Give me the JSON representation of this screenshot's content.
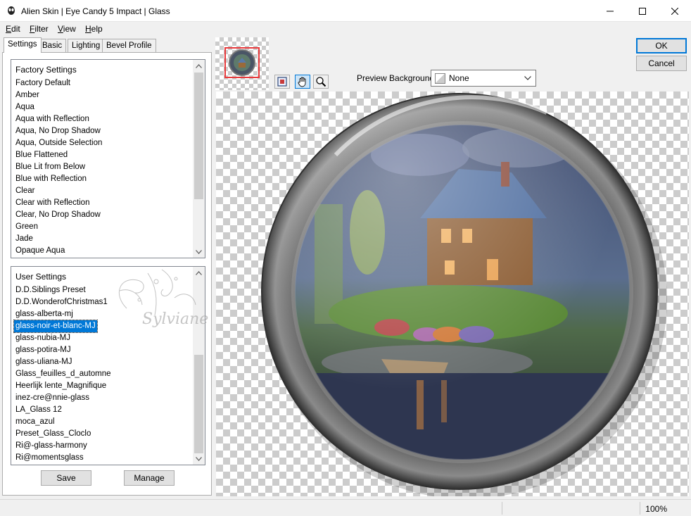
{
  "window": {
    "title": "Alien Skin | Eye Candy 5 Impact | Glass",
    "controls": [
      "minimize",
      "maximize",
      "close"
    ]
  },
  "menu": [
    {
      "label": "Edit",
      "accel": "E",
      "rest": "dit"
    },
    {
      "label": "Filter",
      "accel": "F",
      "rest": "ilter"
    },
    {
      "label": "View",
      "accel": "V",
      "rest": "iew"
    },
    {
      "label": "Help",
      "accel": "H",
      "rest": "elp"
    }
  ],
  "tabs": [
    {
      "label": "Settings",
      "active": true
    },
    {
      "label": "Basic",
      "active": false
    },
    {
      "label": "Lighting",
      "active": false
    },
    {
      "label": "Bevel Profile",
      "active": false
    }
  ],
  "factory_settings": {
    "header": "Factory Settings",
    "items": [
      "Factory Default",
      "Amber",
      "Aqua",
      "Aqua with Reflection",
      "Aqua, No Drop Shadow",
      "Aqua, Outside Selection",
      "Blue Flattened",
      "Blue Lit from Below",
      "Blue with Reflection",
      "Clear",
      "Clear with Reflection",
      "Clear, No Drop Shadow",
      "Green",
      "Jade",
      "Opaque Aqua"
    ]
  },
  "user_settings": {
    "header": "User Settings",
    "selected": "glass-noir-et-blanc-MJ",
    "items": [
      "D.D.Siblings Preset",
      "D.D.WonderofChristmas1",
      "glass-alberta-mj",
      "glass-noir-et-blanc-MJ",
      "glass-nubia-MJ",
      "glass-potira-MJ",
      "glass-uliana-MJ",
      "Glass_feuilles_d_automne",
      "Heerlijk lente_Magnifique",
      "inez-cre@nnie-glass",
      "LA_Glass 12",
      "moca_azul",
      "Preset_Glass_Cloclo",
      "Ri@-glass-harmony",
      "Ri@momentsglass"
    ]
  },
  "watermark": {
    "text": "Sylviane"
  },
  "buttons": {
    "save": "Save",
    "manage": "Manage",
    "ok": "OK",
    "cancel": "Cancel"
  },
  "preview_toolbar": {
    "tools": [
      "preview-navigate-icon",
      "hand-icon",
      "zoom-icon"
    ],
    "background_label": "Preview Background:",
    "background_value": "None"
  },
  "status": {
    "zoom": "100%"
  },
  "colors": {
    "accent": "#0078d7",
    "thumb_border": "#e8393b",
    "window_bg": "#f0f0f0"
  }
}
